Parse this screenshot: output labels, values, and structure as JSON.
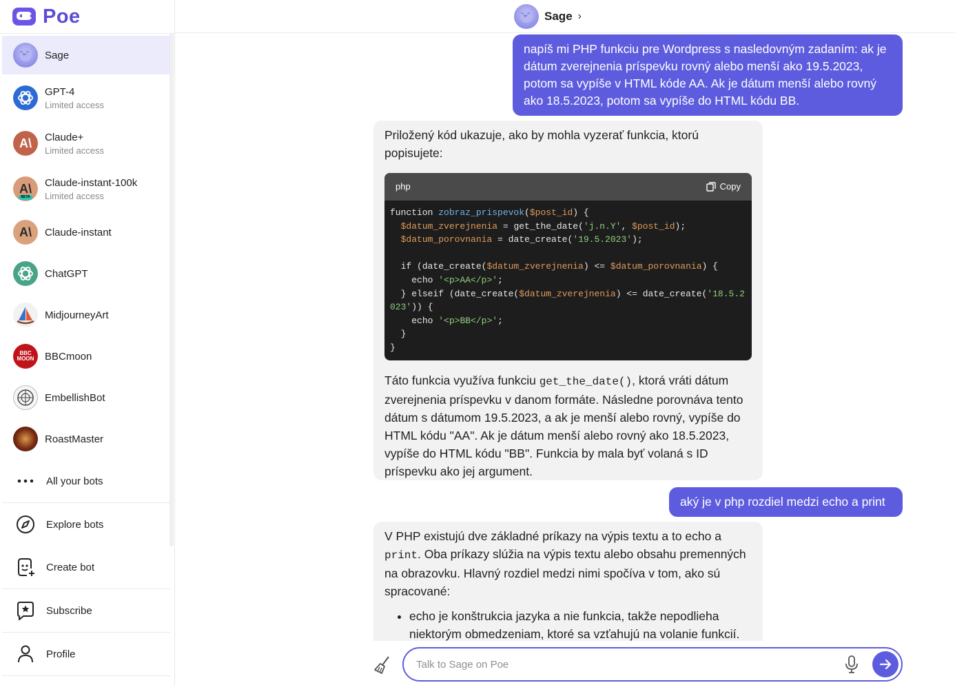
{
  "app": {
    "logo_text": "Poe"
  },
  "sidebar": {
    "bots": [
      {
        "name": "Sage",
        "sub": "",
        "icon": "sage-avatar"
      },
      {
        "name": "GPT-4",
        "sub": "Limited access",
        "icon": "gpt4-avatar"
      },
      {
        "name": "Claude+",
        "sub": "Limited access",
        "icon": "claude-plus-avatar"
      },
      {
        "name": "Claude-instant-100k",
        "sub": "Limited access",
        "icon": "claude-instant-100k-avatar"
      },
      {
        "name": "Claude-instant",
        "sub": "",
        "icon": "claude-instant-avatar"
      },
      {
        "name": "ChatGPT",
        "sub": "",
        "icon": "chatgpt-avatar"
      },
      {
        "name": "MidjourneyArt",
        "sub": "",
        "icon": "midjourneyart-avatar"
      },
      {
        "name": "BBCmoon",
        "sub": "",
        "icon": "bbcmoon-avatar"
      },
      {
        "name": "EmbellishBot",
        "sub": "",
        "icon": "embellishbot-avatar"
      },
      {
        "name": "RoastMaster",
        "sub": "",
        "icon": "roastmaster-avatar"
      }
    ],
    "all_bots_label": "All your bots",
    "explore_label": "Explore bots",
    "create_label": "Create bot",
    "subscribe_label": "Subscribe",
    "profile_label": "Profile",
    "claude_glyph": "A\\",
    "beta_badge": "BETA",
    "bbc_line1": "BBC",
    "bbc_line2": "MOON"
  },
  "header": {
    "title": "Sage"
  },
  "messages": {
    "user1": "napíš mi PHP funkciu pre Wordpress s nasledovným zadaním: ak je dátum zverejnenia príspevku rovný alebo menší ako 19.5.2023, potom sa vypíše v HTML kóde AA. Ak je dátum menší alebo rovný ako 18.5.2023, potom sa vypíše do HTML kódu BB.",
    "bot1_intro": "Priložený kód ukazuje, ako by mohla vyzerať funkcia, ktorú popisujete:",
    "code_lang": "php",
    "copy_label": "Copy",
    "code": {
      "l1_kw": "function ",
      "l1_fn": "zobraz_prispevok",
      "l1_p": "(",
      "l1_var": "$post_id",
      "l1_end": ") {",
      "l2_var": "  $datum_zverejnenia",
      "l2_mid": " = get_the_date(",
      "l2_str": "'j.n.Y'",
      "l2_sep": ", ",
      "l2_var2": "$post_id",
      "l2_end": ");",
      "l3_var": "  $datum_porovnania",
      "l3_mid": " = date_create(",
      "l3_str": "'19.5.2023'",
      "l3_end": ");",
      "l5_a": "  if (date_create(",
      "l5_var": "$datum_zverejnenia",
      "l5_b": ") <= ",
      "l5_var2": "$datum_porovnania",
      "l5_end": ") {",
      "l6_a": "    echo ",
      "l6_str": "'<p>AA</p>'",
      "l6_end": ";",
      "l7_a": "  } elseif (date_create(",
      "l7_var": "$datum_zverejnenia",
      "l7_b": ") <= date_create(",
      "l7_str": "'18.5.2023'",
      "l7_end": ")) {",
      "l8_a": "    echo ",
      "l8_str": "'<p>BB</p>'",
      "l8_end": ";",
      "l9": "  }",
      "l10": "}"
    },
    "bot1_after_a": "Táto funkcia využíva funkciu ",
    "bot1_after_code": "get_the_date()",
    "bot1_after_b": ", ktorá vráti dátum zverejnenia príspevku v danom formáte. Následne porovnáva tento dátum s dátumom 19.5.2023, a ak je menší alebo rovný, vypíše do HTML kódu \"AA\". Ak je dátum menší alebo rovný ako 18.5.2023, vypíše do HTML kódu \"BB\". Funkcia by mala byť volaná s ID príspevku ako jej argument.",
    "user2": "aký je v php rozdiel medzi echo a print",
    "bot2_a": "V PHP existujú dve základné príkazy na výpis textu a to echo a ",
    "bot2_code": "print",
    "bot2_b": ". Oba príkazy slúžia na výpis textu alebo obsahu premenných na obrazovku. Hlavný rozdiel medzi nimi spočíva v tom, ako sú spracované:",
    "bot2_bullet1": "echo je konštrukcia jazyka a nie funkcia, takže nepodlieha niektorým obmedzeniam, ktoré sa vzťahujú na volanie funkcií."
  },
  "composer": {
    "placeholder": "Talk to Sage on Poe",
    "value": ""
  },
  "colors": {
    "accent": "#5d5cde",
    "active_bg": "#ebebfb",
    "bot_bubble": "#f2f2f2",
    "code_bg": "#1d1d1d"
  }
}
